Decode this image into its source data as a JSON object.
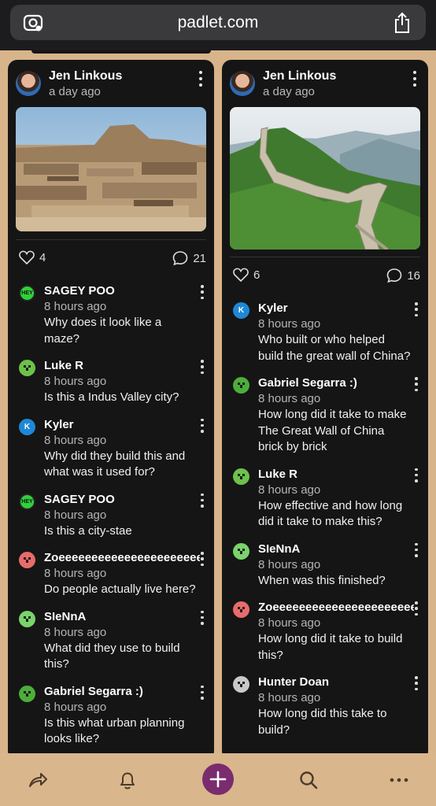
{
  "browser": {
    "url": "padlet.com"
  },
  "posts": [
    {
      "author": "Jen Linkous",
      "ago": "a day ago",
      "likes": "4",
      "comments_count": "21",
      "comments": [
        {
          "name": "SAGEY POO",
          "time": "8 hours ago",
          "text": "Why does it look like a maze?",
          "avatar": "hey",
          "color": "#1b8f2a"
        },
        {
          "name": "Luke R",
          "time": "8 hours ago",
          "text": "Is this a Indus Valley city?",
          "avatar": "creeper",
          "color": "#6cc14a"
        },
        {
          "name": "Kyler",
          "time": "8 hours ago",
          "text": "Why did they build this and what was it used for?",
          "avatar": "K",
          "color": "#1e88d6"
        },
        {
          "name": "SAGEY POO",
          "time": "8 hours ago",
          "text": "Is this a city-stae",
          "avatar": "hey",
          "color": "#1b8f2a"
        },
        {
          "name": "Zoeeeeeeeeeeeeeeeeeeeeee",
          "time": "8 hours ago",
          "text": "Do people actually live here?",
          "avatar": "pig",
          "color": "#e96b6b"
        },
        {
          "name": "SIeNnA",
          "time": "8 hours ago",
          "text": "What did they use to build this?",
          "avatar": "frog",
          "color": "#7ad36b"
        },
        {
          "name": "Gabriel Segarra :)",
          "time": "8 hours ago",
          "text": "Is this what urban planning looks like?",
          "avatar": "creeper2",
          "color": "#4cae3a"
        }
      ]
    },
    {
      "author": "Jen Linkous",
      "ago": "a day ago",
      "likes": "6",
      "comments_count": "16",
      "comments": [
        {
          "name": "Kyler",
          "time": "8 hours ago",
          "text": "Who built or who helped build the great wall of China?",
          "avatar": "K",
          "color": "#1e88d6"
        },
        {
          "name": "Gabriel Segarra :)",
          "time": "8 hours ago",
          "text": "How long did it take to make The Great Wall of China brick by brick",
          "avatar": "creeper2",
          "color": "#4cae3a"
        },
        {
          "name": "Luke R",
          "time": "8 hours ago",
          "text": "How effective and how long did it take to make this?",
          "avatar": "creeper",
          "color": "#6cc14a"
        },
        {
          "name": "SIeNnA",
          "time": "8 hours ago",
          "text": "When was this finished?",
          "avatar": "frog",
          "color": "#7ad36b"
        },
        {
          "name": "Zoeeeeeeeeeeeeeeeeeeeeee",
          "time": "8 hours ago",
          "text": "How long did it take to build this?",
          "avatar": "pig",
          "color": "#e96b6b"
        },
        {
          "name": "Hunter Doan",
          "time": "8 hours ago",
          "text": "How long did this take to build?",
          "avatar": "skull",
          "color": "#c9c9c9"
        }
      ]
    }
  ],
  "bottom_nav": [
    "share-icon",
    "bell-icon",
    "add-icon",
    "search-icon",
    "more-icon"
  ],
  "colors": {
    "background": "#d8b48a",
    "card": "#151515",
    "accent": "#7a2c6e"
  }
}
